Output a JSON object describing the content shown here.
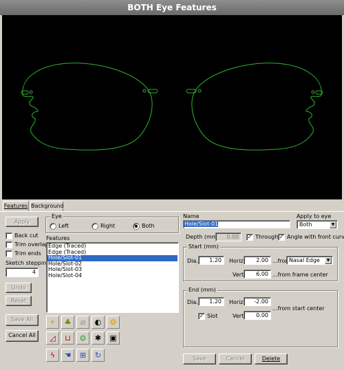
{
  "window": {
    "title": "BOTH Eye Features"
  },
  "tabs": [
    {
      "label": "Features"
    },
    {
      "label": "Background"
    }
  ],
  "left_panel": {
    "apply_label": "Apply",
    "back_cut_label": "Back cut",
    "trim_overlaps_label": "Trim overlaps",
    "trim_ends_label": "Trim ends",
    "sketch_stepping_label": "Sketch stepping",
    "sketch_stepping_value": "4",
    "undo_label": "Undo",
    "reset_label": "Reset",
    "save_all_label": "Save All",
    "cancel_all_label": "Cancel All"
  },
  "eye": {
    "label": "Eye",
    "options": [
      "Left",
      "Right",
      "Both"
    ],
    "selected": "Both"
  },
  "features": {
    "label": "Features",
    "items": [
      "Edge (Traced)",
      "Edge (Traced)",
      "Hole/Slot-01",
      "Hole/Slot-02",
      "Hole/Slot-03",
      "Hole/Slot-04"
    ],
    "selected_index": 2
  },
  "toolbar": {
    "icons": [
      "lightning-icon",
      "tree-icon",
      "hatch-icon",
      "contrast-icon",
      "bag-icon",
      "bevel-icon",
      "notch-icon",
      "circle-icon",
      "bug-icon",
      "save-disk-icon",
      "wave-tool-icon",
      "hand-icon",
      "measure-icon",
      "rotate-icon"
    ]
  },
  "right_panel": {
    "name_label": "Name",
    "name_value": "Hole/Slot-01",
    "apply_to_eye_label": "Apply to eye",
    "apply_to_eye_value": "Both",
    "depth_label": "Depth (mm)",
    "depth_value": "0.00",
    "through_label": "Through",
    "angle_label": "Angle with front curve",
    "start": {
      "title": "Start (mm)",
      "dia_label": "Dia.",
      "dia_value": "1.20",
      "horiz_label": "Horiz.",
      "horiz_value": "2.00",
      "from_label": "...from",
      "from_value": "Nasal Edge",
      "vert_label": "Vert.",
      "vert_value": "6.00",
      "vert_from": "...from frame center"
    },
    "end": {
      "title": "End (mm)",
      "dia_label": "Dia.",
      "dia_value": "1.20",
      "horiz_label": "Horiz.",
      "horiz_value": "-2.00",
      "horiz_from": "...from start center",
      "slot_label": "Slot",
      "vert_label": "Vert.",
      "vert_value": "0.00"
    },
    "save_label": "Save",
    "cancel_label": "Cancel",
    "delete_label": "Delete"
  },
  "colors": {
    "lens_outline": "#2db52d",
    "selection": "#316ac5"
  }
}
